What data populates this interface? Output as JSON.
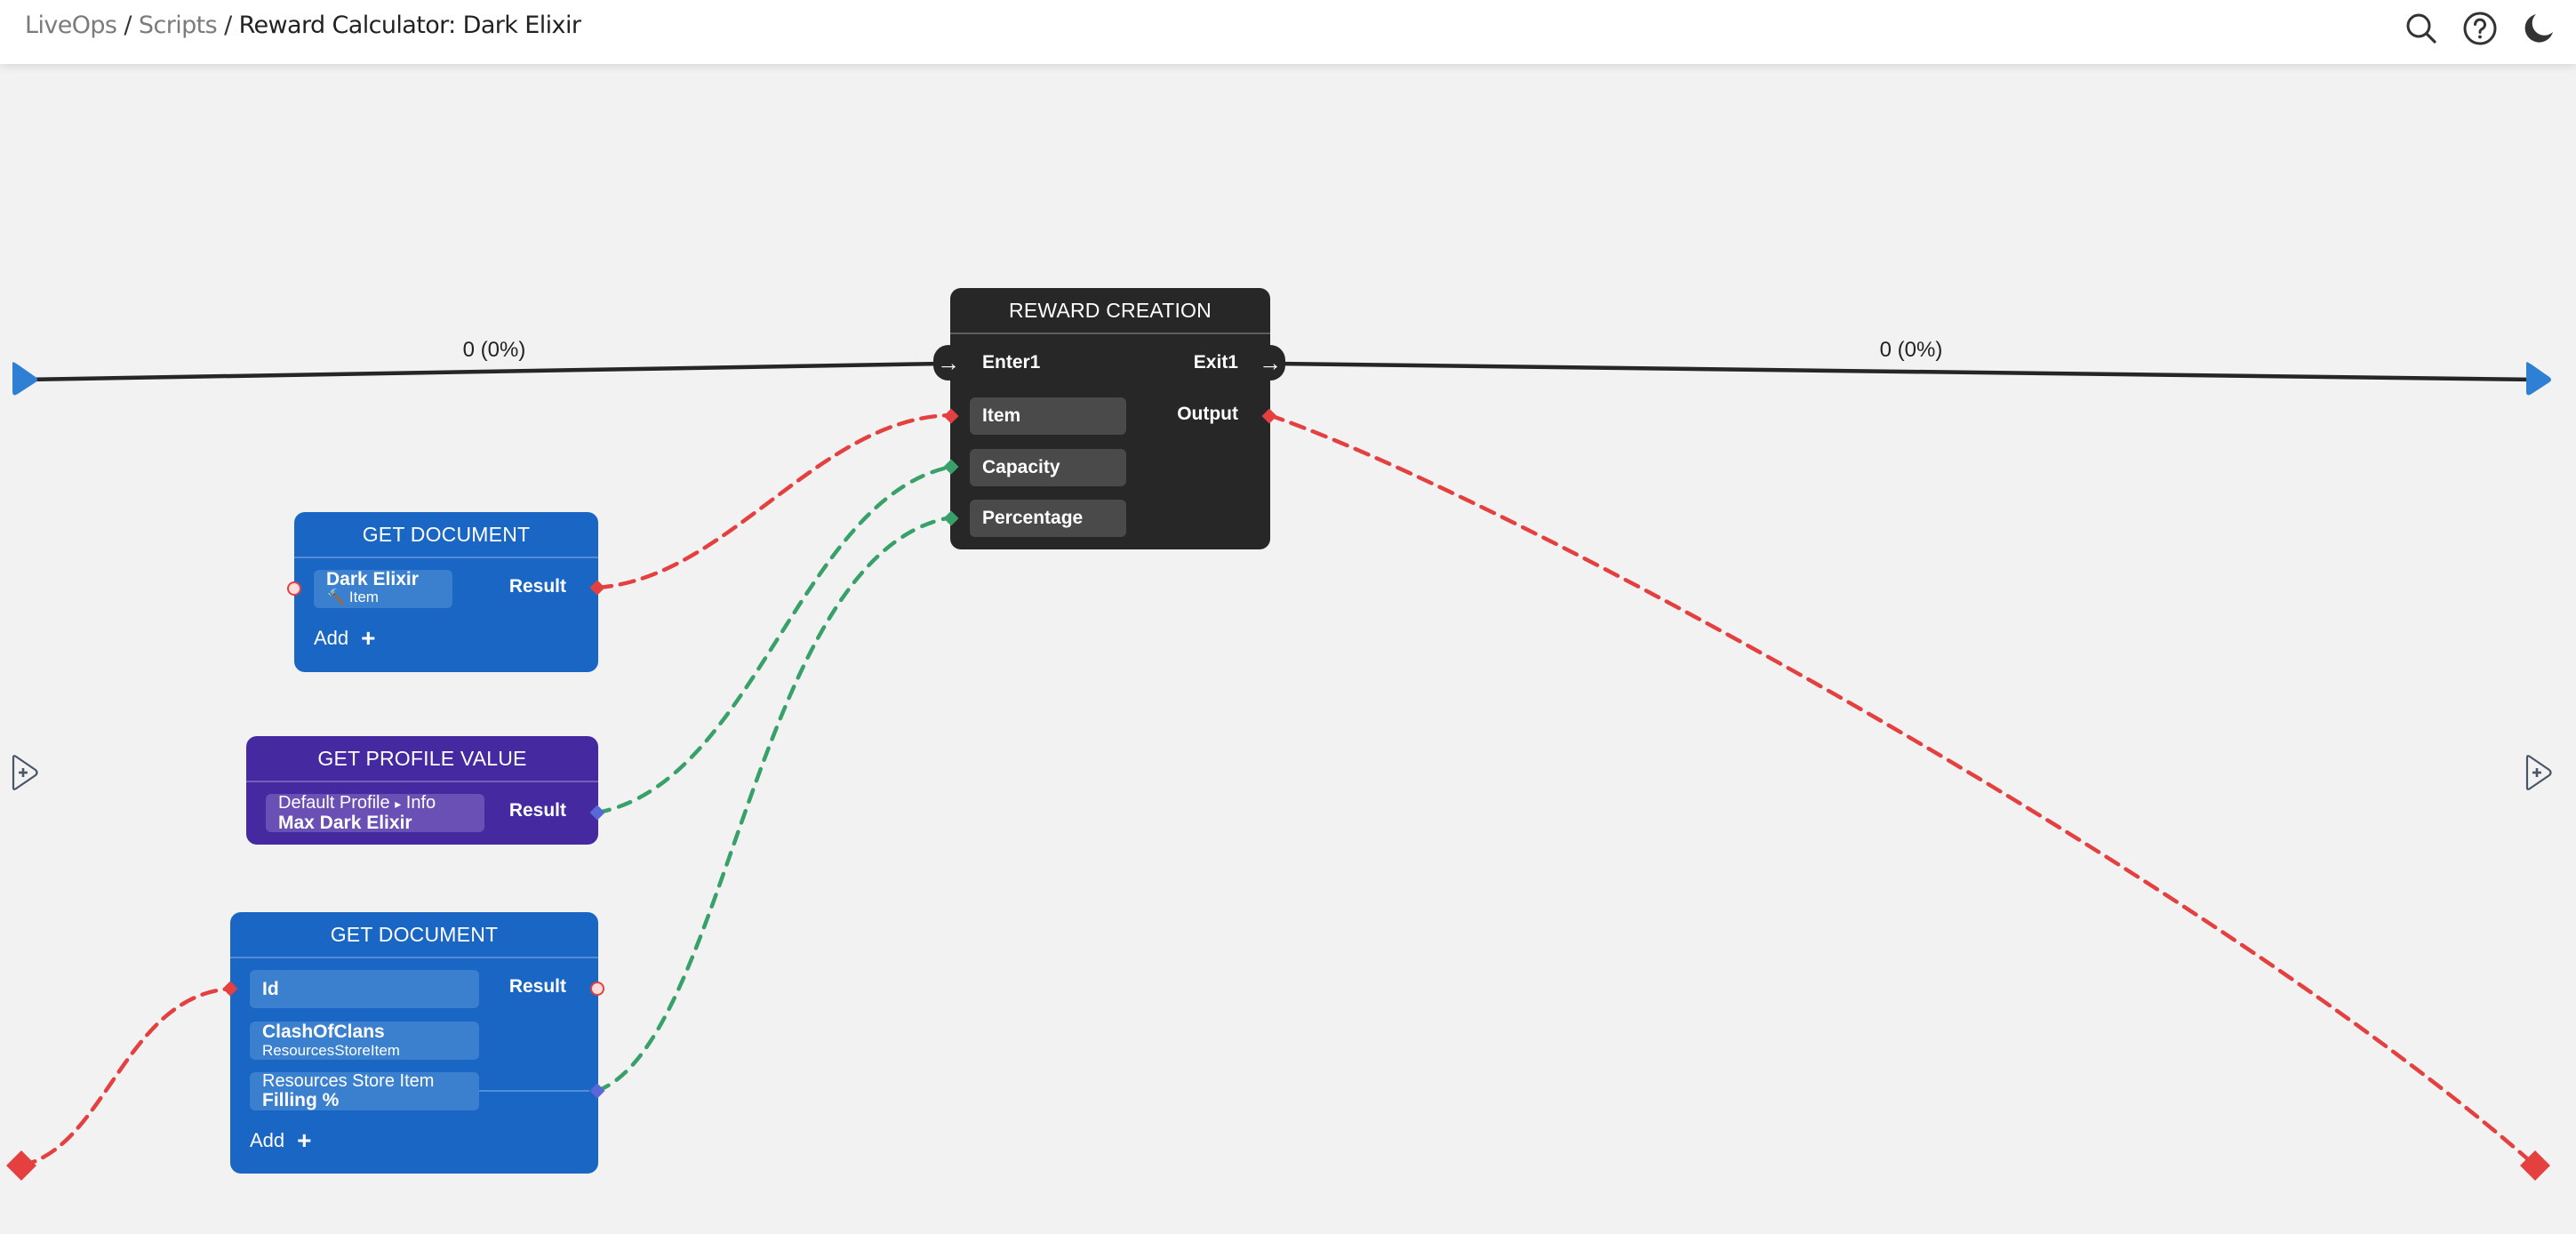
{
  "header": {
    "breadcrumb": [
      {
        "label": "LiveOps",
        "link": true
      },
      {
        "label": "Scripts",
        "link": true
      },
      {
        "label": "Reward Calculator: Dark Elixir",
        "link": false
      }
    ],
    "separator": "/",
    "icons": [
      "search-icon",
      "help-icon",
      "dark-mode-icon"
    ]
  },
  "flow": {
    "start_edge_label": "0 (0%)",
    "end_edge_label": "0 (0%)"
  },
  "colors": {
    "flow_line": "#262626",
    "entry_exit_marker": "#2f7fd4",
    "item_wire": "#e44040",
    "number_wire": "#38a169",
    "node_dark": "#272727",
    "node_document": "#1a66c4",
    "node_profile": "#4429a1",
    "canvas_bg": "#f2f2f2"
  },
  "nodes": {
    "reward_creation": {
      "title": "REWARD CREATION",
      "enter": "Enter1",
      "exit": "Exit1",
      "inputs": [
        "Item",
        "Capacity",
        "Percentage"
      ],
      "output": "Output"
    },
    "get_document_1": {
      "title": "GET DOCUMENT",
      "param_title": "Dark Elixir",
      "param_subtitle": "Item",
      "param_icon": "hammer-icon",
      "result": "Result",
      "add_label": "Add",
      "add_icon": "+"
    },
    "get_profile_value": {
      "title": "GET PROFILE VALUE",
      "param_path": "Default Profile",
      "param_path_sep": "▸",
      "param_path_leaf": "Info",
      "param_value": "Max Dark Elixir",
      "result": "Result"
    },
    "get_document_2": {
      "title": "GET DOCUMENT",
      "id_label": "Id",
      "param_title": "ClashOfClans",
      "param_subtitle": "ResourcesStoreItem",
      "field_title": "Resources Store Item",
      "field_value": "Filling %",
      "result": "Result",
      "add_label": "Add",
      "add_icon": "+"
    }
  }
}
